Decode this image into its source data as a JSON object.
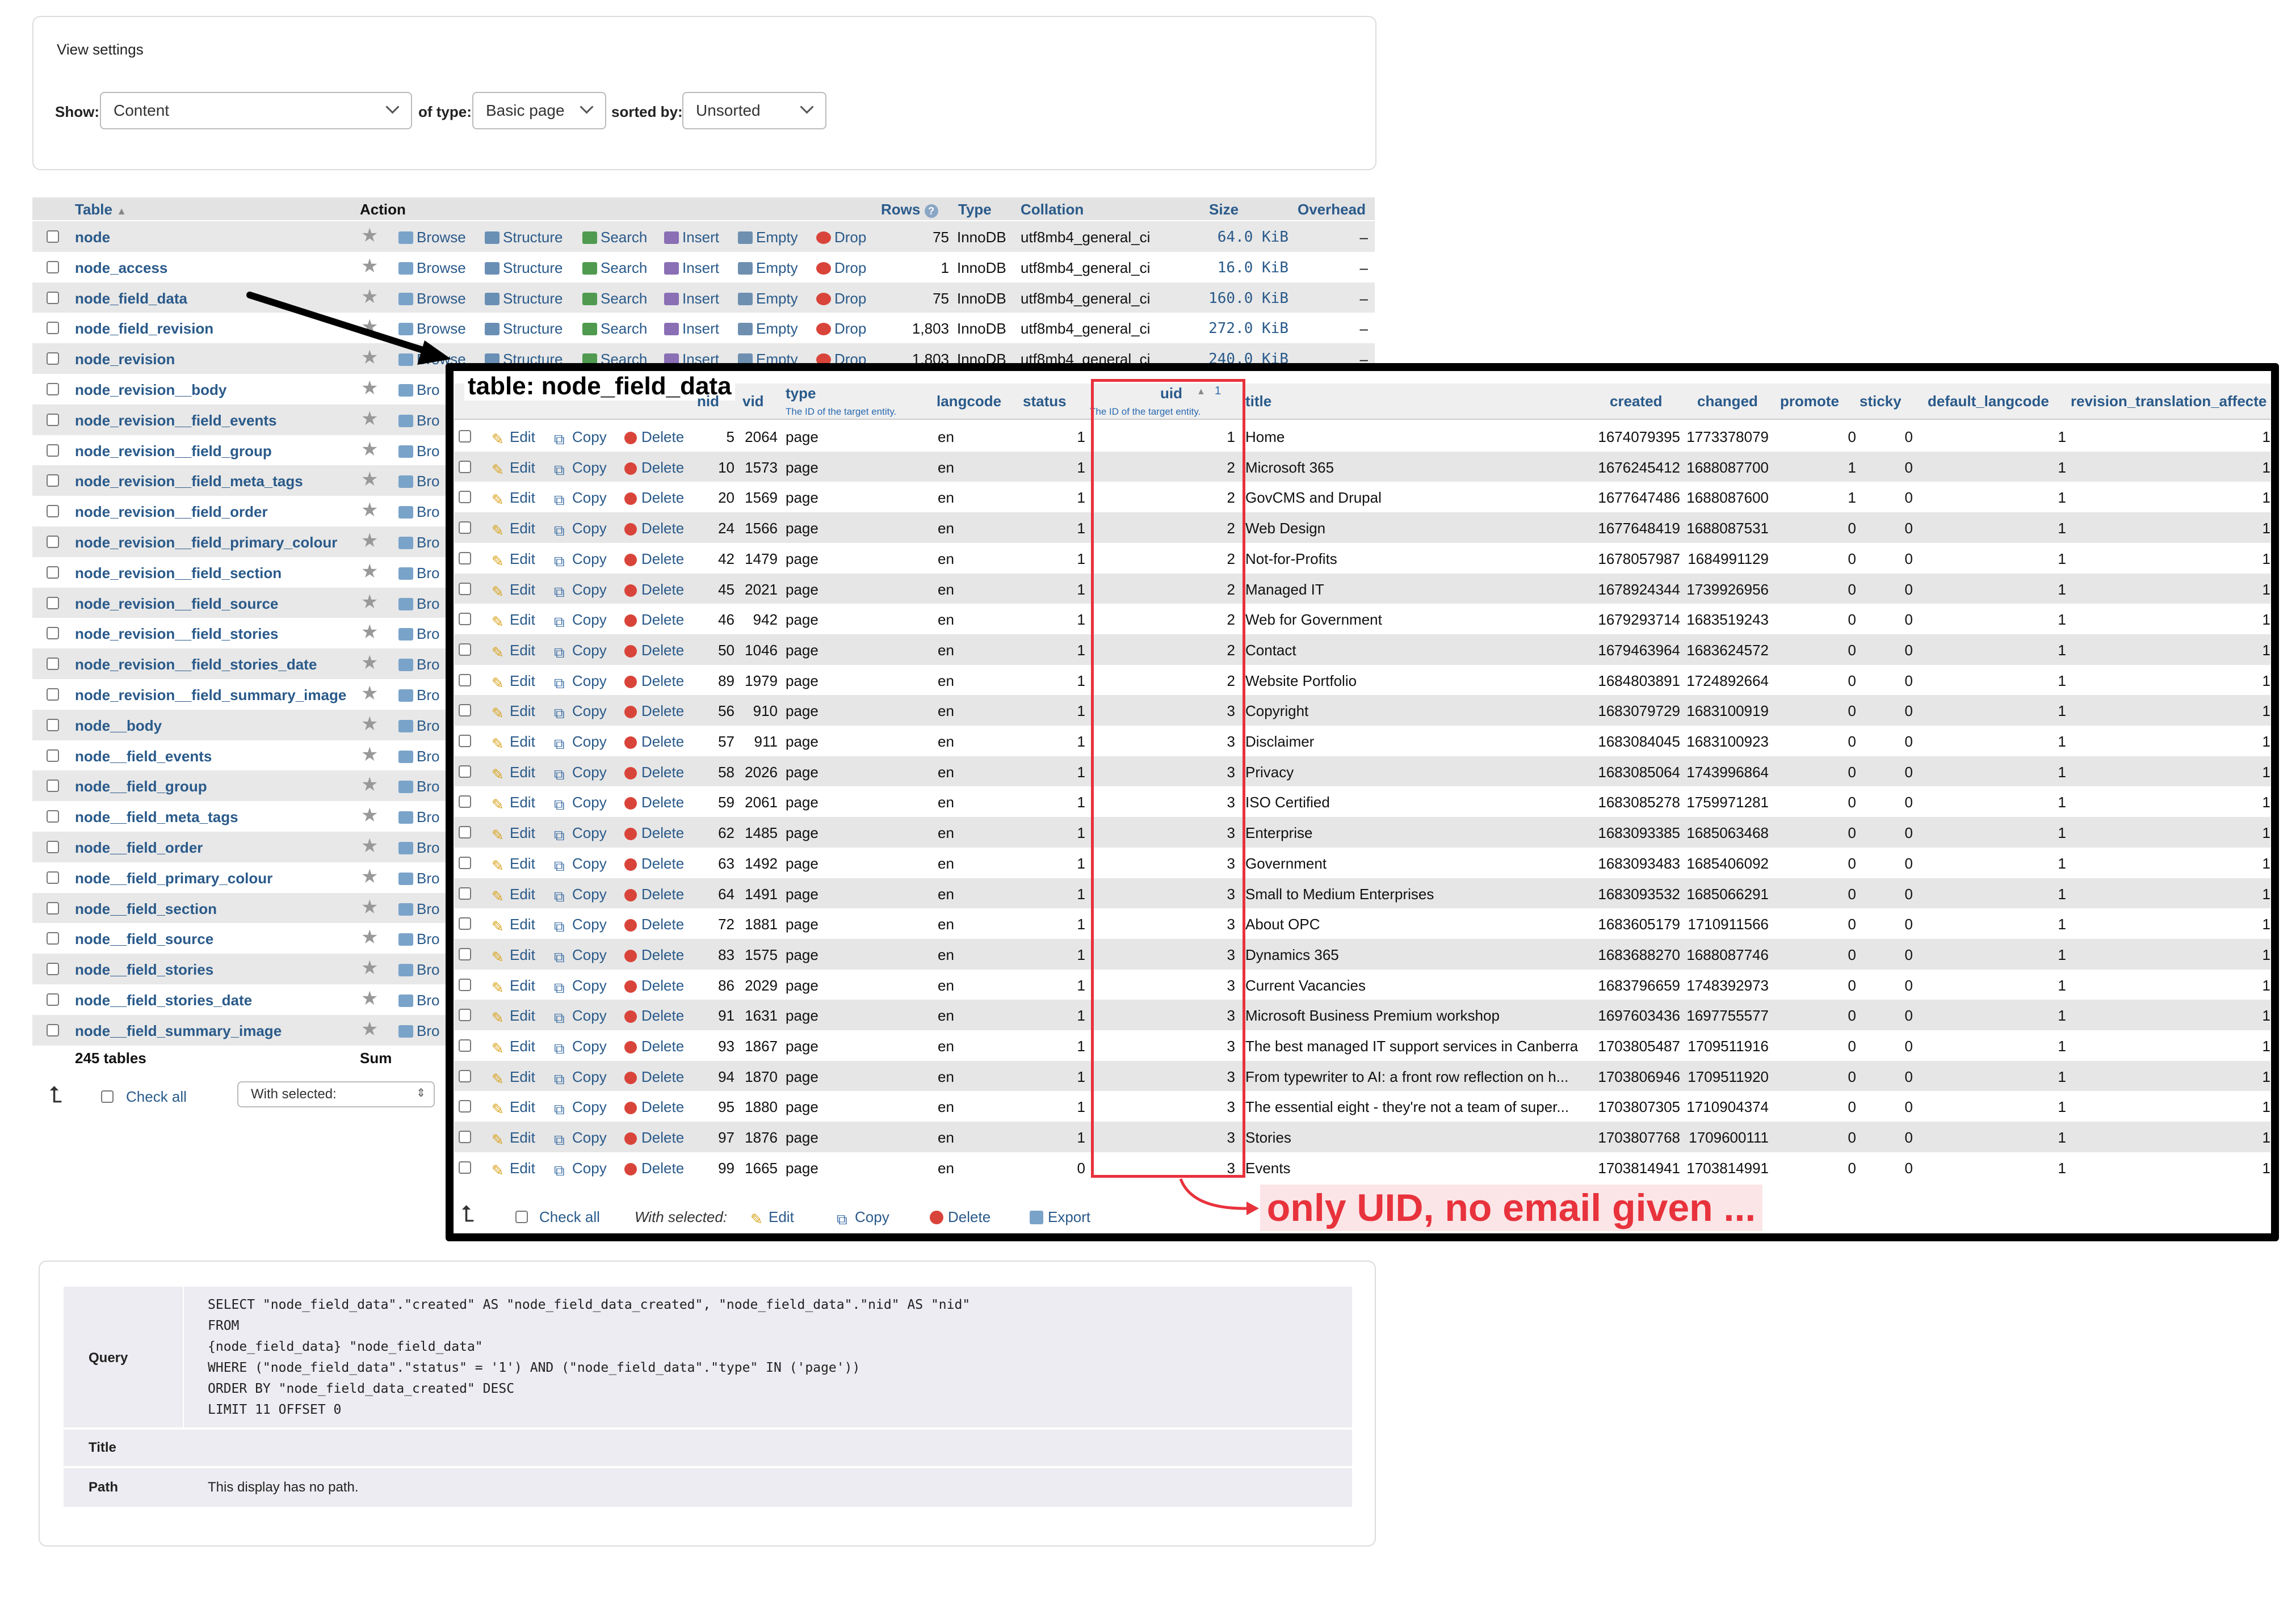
{
  "view_settings": {
    "title": "View settings",
    "show_label": "Show:",
    "show_value": "Content",
    "type_label": "of type:",
    "type_value": "Basic page",
    "sort_label": "sorted by:",
    "sort_value": "Unsorted"
  },
  "table_list": {
    "headers": {
      "table": "Table",
      "action": "Action",
      "rows": "Rows",
      "type": "Type",
      "collation": "Collation",
      "size": "Size",
      "overhead": "Overhead"
    },
    "actions": [
      "Browse",
      "Structure",
      "Search",
      "Insert",
      "Empty",
      "Drop"
    ],
    "action_short": "Bro",
    "rows": [
      {
        "name": "node",
        "rows": "75",
        "type": "InnoDB",
        "collation": "utf8mb4_general_ci",
        "size": "64.0 KiB",
        "overhead": "–"
      },
      {
        "name": "node_access",
        "rows": "1",
        "type": "InnoDB",
        "collation": "utf8mb4_general_ci",
        "size": "16.0 KiB",
        "overhead": "–"
      },
      {
        "name": "node_field_data",
        "rows": "75",
        "type": "InnoDB",
        "collation": "utf8mb4_general_ci",
        "size": "160.0 KiB",
        "overhead": "–"
      },
      {
        "name": "node_field_revision",
        "rows": "1,803",
        "type": "InnoDB",
        "collation": "utf8mb4_general_ci",
        "size": "272.0 KiB",
        "overhead": "–"
      },
      {
        "name": "node_revision",
        "rows": "1,803",
        "type": "InnoDB",
        "collation": "utf8mb4_general_ci",
        "size": "240.0 KiB",
        "overhead": "–"
      },
      {
        "name": "node_revision__body"
      },
      {
        "name": "node_revision__field_events"
      },
      {
        "name": "node_revision__field_group"
      },
      {
        "name": "node_revision__field_meta_tags"
      },
      {
        "name": "node_revision__field_order"
      },
      {
        "name": "node_revision__field_primary_colour"
      },
      {
        "name": "node_revision__field_section"
      },
      {
        "name": "node_revision__field_source"
      },
      {
        "name": "node_revision__field_stories"
      },
      {
        "name": "node_revision__field_stories_date"
      },
      {
        "name": "node_revision__field_summary_image"
      },
      {
        "name": "node__body"
      },
      {
        "name": "node__field_events"
      },
      {
        "name": "node__field_group"
      },
      {
        "name": "node__field_meta_tags"
      },
      {
        "name": "node__field_order"
      },
      {
        "name": "node__field_primary_colour"
      },
      {
        "name": "node__field_section"
      },
      {
        "name": "node__field_source"
      },
      {
        "name": "node__field_stories"
      },
      {
        "name": "node__field_stories_date"
      },
      {
        "name": "node__field_summary_image"
      }
    ],
    "footer_count": "245 tables",
    "footer_sum": "Sum",
    "check_all": "Check all",
    "with_selected": "With selected:"
  },
  "overlay": {
    "title": "table: node_field_data",
    "columns": {
      "nid": "nid",
      "vid": "vid",
      "type": "type",
      "type_note": "The ID of the target entity.",
      "langcode": "langcode",
      "status": "status",
      "uid": "uid",
      "uid_sort": "1",
      "uid_note": "The ID of the target entity.",
      "title": "title",
      "created": "created",
      "changed": "changed",
      "promote": "promote",
      "sticky": "sticky",
      "default_langcode": "default_langcode",
      "revision_translation_affected": "revision_translation_affecte"
    },
    "row_actions": {
      "edit": "Edit",
      "copy": "Copy",
      "delete": "Delete"
    },
    "rows": [
      {
        "nid": "5",
        "vid": "2064",
        "type": "page",
        "langcode": "en",
        "status": "1",
        "uid": "1",
        "title": "Home",
        "created": "1674079395",
        "changed": "1773378079",
        "promote": "0",
        "sticky": "0",
        "default_langcode": "1",
        "rta": "1"
      },
      {
        "nid": "10",
        "vid": "1573",
        "type": "page",
        "langcode": "en",
        "status": "1",
        "uid": "2",
        "title": "Microsoft 365",
        "created": "1676245412",
        "changed": "1688087700",
        "promote": "1",
        "sticky": "0",
        "default_langcode": "1",
        "rta": "1"
      },
      {
        "nid": "20",
        "vid": "1569",
        "type": "page",
        "langcode": "en",
        "status": "1",
        "uid": "2",
        "title": "GovCMS and Drupal",
        "created": "1677647486",
        "changed": "1688087600",
        "promote": "1",
        "sticky": "0",
        "default_langcode": "1",
        "rta": "1"
      },
      {
        "nid": "24",
        "vid": "1566",
        "type": "page",
        "langcode": "en",
        "status": "1",
        "uid": "2",
        "title": "Web Design",
        "created": "1677648419",
        "changed": "1688087531",
        "promote": "0",
        "sticky": "0",
        "default_langcode": "1",
        "rta": "1"
      },
      {
        "nid": "42",
        "vid": "1479",
        "type": "page",
        "langcode": "en",
        "status": "1",
        "uid": "2",
        "title": "Not-for-Profits",
        "created": "1678057987",
        "changed": "1684991129",
        "promote": "0",
        "sticky": "0",
        "default_langcode": "1",
        "rta": "1"
      },
      {
        "nid": "45",
        "vid": "2021",
        "type": "page",
        "langcode": "en",
        "status": "1",
        "uid": "2",
        "title": "Managed IT",
        "created": "1678924344",
        "changed": "1739926956",
        "promote": "0",
        "sticky": "0",
        "default_langcode": "1",
        "rta": "1"
      },
      {
        "nid": "46",
        "vid": "942",
        "type": "page",
        "langcode": "en",
        "status": "1",
        "uid": "2",
        "title": "Web for Government",
        "created": "1679293714",
        "changed": "1683519243",
        "promote": "0",
        "sticky": "0",
        "default_langcode": "1",
        "rta": "1"
      },
      {
        "nid": "50",
        "vid": "1046",
        "type": "page",
        "langcode": "en",
        "status": "1",
        "uid": "2",
        "title": "Contact",
        "created": "1679463964",
        "changed": "1683624572",
        "promote": "0",
        "sticky": "0",
        "default_langcode": "1",
        "rta": "1"
      },
      {
        "nid": "89",
        "vid": "1979",
        "type": "page",
        "langcode": "en",
        "status": "1",
        "uid": "2",
        "title": "Website Portfolio",
        "created": "1684803891",
        "changed": "1724892664",
        "promote": "0",
        "sticky": "0",
        "default_langcode": "1",
        "rta": "1"
      },
      {
        "nid": "56",
        "vid": "910",
        "type": "page",
        "langcode": "en",
        "status": "1",
        "uid": "3",
        "title": "Copyright",
        "created": "1683079729",
        "changed": "1683100919",
        "promote": "0",
        "sticky": "0",
        "default_langcode": "1",
        "rta": "1"
      },
      {
        "nid": "57",
        "vid": "911",
        "type": "page",
        "langcode": "en",
        "status": "1",
        "uid": "3",
        "title": "Disclaimer",
        "created": "1683084045",
        "changed": "1683100923",
        "promote": "0",
        "sticky": "0",
        "default_langcode": "1",
        "rta": "1"
      },
      {
        "nid": "58",
        "vid": "2026",
        "type": "page",
        "langcode": "en",
        "status": "1",
        "uid": "3",
        "title": "Privacy",
        "created": "1683085064",
        "changed": "1743996864",
        "promote": "0",
        "sticky": "0",
        "default_langcode": "1",
        "rta": "1"
      },
      {
        "nid": "59",
        "vid": "2061",
        "type": "page",
        "langcode": "en",
        "status": "1",
        "uid": "3",
        "title": "ISO Certified",
        "created": "1683085278",
        "changed": "1759971281",
        "promote": "0",
        "sticky": "0",
        "default_langcode": "1",
        "rta": "1"
      },
      {
        "nid": "62",
        "vid": "1485",
        "type": "page",
        "langcode": "en",
        "status": "1",
        "uid": "3",
        "title": "Enterprise",
        "created": "1683093385",
        "changed": "1685063468",
        "promote": "0",
        "sticky": "0",
        "default_langcode": "1",
        "rta": "1"
      },
      {
        "nid": "63",
        "vid": "1492",
        "type": "page",
        "langcode": "en",
        "status": "1",
        "uid": "3",
        "title": "Government",
        "created": "1683093483",
        "changed": "1685406092",
        "promote": "0",
        "sticky": "0",
        "default_langcode": "1",
        "rta": "1"
      },
      {
        "nid": "64",
        "vid": "1491",
        "type": "page",
        "langcode": "en",
        "status": "1",
        "uid": "3",
        "title": "Small to Medium Enterprises",
        "created": "1683093532",
        "changed": "1685066291",
        "promote": "0",
        "sticky": "0",
        "default_langcode": "1",
        "rta": "1"
      },
      {
        "nid": "72",
        "vid": "1881",
        "type": "page",
        "langcode": "en",
        "status": "1",
        "uid": "3",
        "title": "About OPC",
        "created": "1683605179",
        "changed": "1710911566",
        "promote": "0",
        "sticky": "0",
        "default_langcode": "1",
        "rta": "1"
      },
      {
        "nid": "83",
        "vid": "1575",
        "type": "page",
        "langcode": "en",
        "status": "1",
        "uid": "3",
        "title": "Dynamics 365",
        "created": "1683688270",
        "changed": "1688087746",
        "promote": "0",
        "sticky": "0",
        "default_langcode": "1",
        "rta": "1"
      },
      {
        "nid": "86",
        "vid": "2029",
        "type": "page",
        "langcode": "en",
        "status": "1",
        "uid": "3",
        "title": "Current Vacancies",
        "created": "1683796659",
        "changed": "1748392973",
        "promote": "0",
        "sticky": "0",
        "default_langcode": "1",
        "rta": "1"
      },
      {
        "nid": "91",
        "vid": "1631",
        "type": "page",
        "langcode": "en",
        "status": "1",
        "uid": "3",
        "title": "Microsoft Business Premium workshop",
        "created": "1697603436",
        "changed": "1697755577",
        "promote": "0",
        "sticky": "0",
        "default_langcode": "1",
        "rta": "1"
      },
      {
        "nid": "93",
        "vid": "1867",
        "type": "page",
        "langcode": "en",
        "status": "1",
        "uid": "3",
        "title": "The best managed IT support services in Canberra",
        "created": "1703805487",
        "changed": "1709511916",
        "promote": "0",
        "sticky": "0",
        "default_langcode": "1",
        "rta": "1"
      },
      {
        "nid": "94",
        "vid": "1870",
        "type": "page",
        "langcode": "en",
        "status": "1",
        "uid": "3",
        "title": "From typewriter to AI: a front row reflection on h...",
        "created": "1703806946",
        "changed": "1709511920",
        "promote": "0",
        "sticky": "0",
        "default_langcode": "1",
        "rta": "1"
      },
      {
        "nid": "95",
        "vid": "1880",
        "type": "page",
        "langcode": "en",
        "status": "1",
        "uid": "3",
        "title": "The essential eight - they're not a team of super...",
        "created": "1703807305",
        "changed": "1710904374",
        "promote": "0",
        "sticky": "0",
        "default_langcode": "1",
        "rta": "1"
      },
      {
        "nid": "97",
        "vid": "1876",
        "type": "page",
        "langcode": "en",
        "status": "1",
        "uid": "3",
        "title": "Stories",
        "created": "1703807768",
        "changed": "1709600111",
        "promote": "0",
        "sticky": "0",
        "default_langcode": "1",
        "rta": "1"
      },
      {
        "nid": "99",
        "vid": "1665",
        "type": "page",
        "langcode": "en",
        "status": "0",
        "uid": "3",
        "title": "Events",
        "created": "1703814941",
        "changed": "1703814991",
        "promote": "0",
        "sticky": "0",
        "default_langcode": "1",
        "rta": "1"
      }
    ],
    "footer": {
      "check_all": "Check all",
      "with_selected": "With selected:",
      "edit": "Edit",
      "copy": "Copy",
      "delete": "Delete",
      "export": "Export"
    },
    "annotation": "only UID, no email given ..."
  },
  "query_panel": {
    "query_label": "Query",
    "query_lines": [
      "SELECT \"node_field_data\".\"created\" AS \"node_field_data_created\", \"node_field_data\".\"nid\" AS \"nid\"",
      "FROM",
      "{node_field_data} \"node_field_data\"",
      "WHERE (\"node_field_data\".\"status\" = '1') AND (\"node_field_data\".\"type\" IN ('page'))",
      "ORDER BY \"node_field_data_created\" DESC",
      "LIMIT 11 OFFSET 0"
    ],
    "title_label": "Title",
    "title_value": "",
    "path_label": "Path",
    "path_value": "This display has no path."
  },
  "colors": {
    "link": "#2a5a8a",
    "highlight": "#e8323c",
    "annotation_bg": "#fbe5e7",
    "row_alt": "#e6e6e6"
  }
}
